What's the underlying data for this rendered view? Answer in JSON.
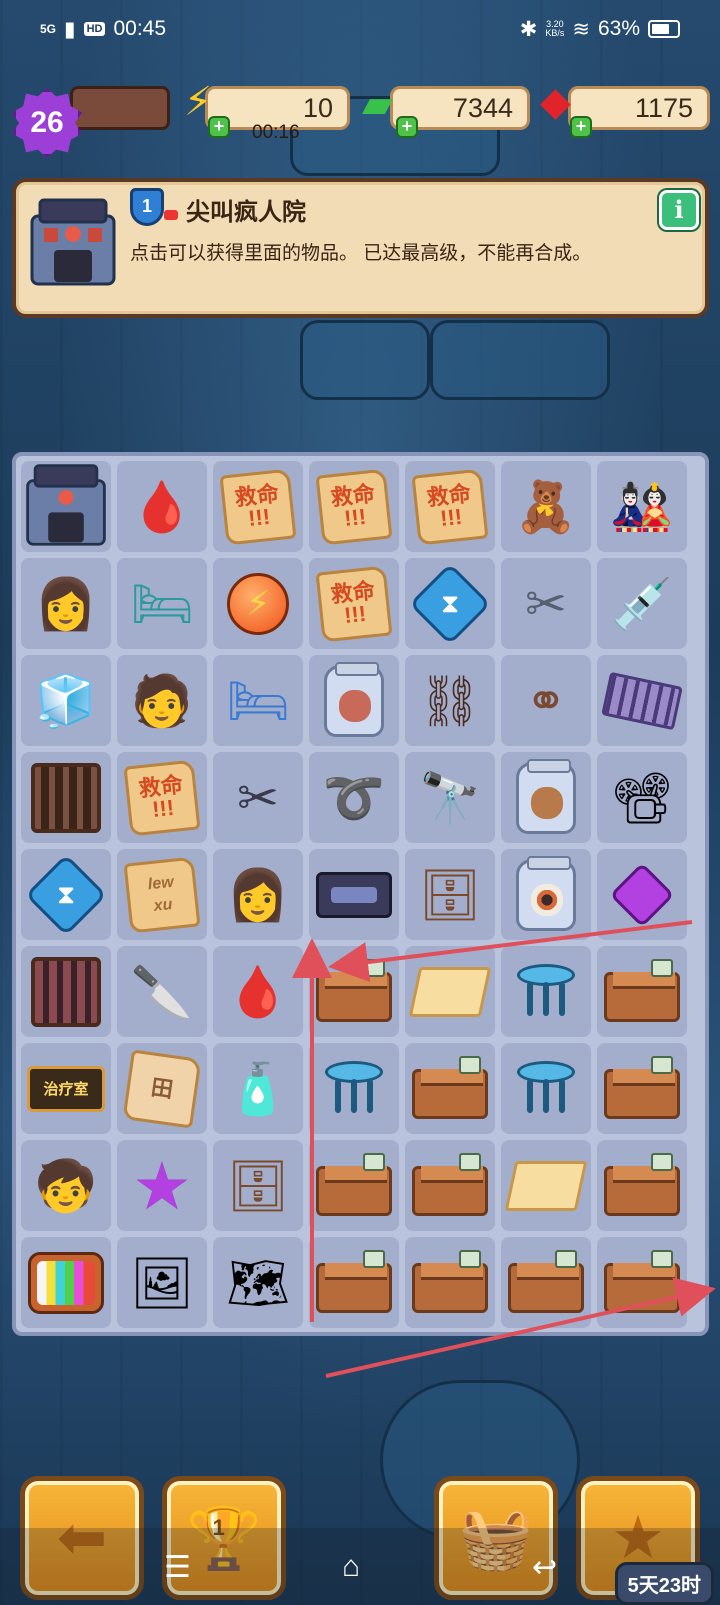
{
  "status_bar": {
    "network": "5G",
    "hd": "HD",
    "time": "00:45",
    "speed_value": "3.20",
    "speed_unit": "KB/s",
    "battery": "63%"
  },
  "resources": {
    "level": "26",
    "energy": "10",
    "energy_timer": "00:16",
    "cash": "7344",
    "gems": "1175"
  },
  "info_panel": {
    "tier": "1",
    "title": "尖叫疯人院",
    "description": "点击可以获得里面的物品。 已达最高级，不能再合成。",
    "info_button": "i"
  },
  "board": {
    "rows": [
      [
        "asylum-building",
        "iv-bag",
        "help-note",
        "help-note",
        "help-note",
        "toy-box",
        "nurse-doll"
      ],
      [
        "nurse-girl",
        "hospital-bed",
        "energy-orb",
        "help-note",
        "hourglass-gem",
        "tweezers",
        "syringe-set"
      ],
      [
        "color-cubes",
        "doctor-syringe",
        "hospital-bed-blue",
        "jar-lungs",
        "ball-chain",
        "handcuffs",
        "film-strip"
      ],
      [
        "cage",
        "help-note",
        "pliers",
        "whip",
        "binoculars",
        "jar-brain",
        "projector"
      ],
      [
        "hourglass-gem",
        "scribble-note",
        "nurse-girl",
        "cassette",
        "desk-items",
        "jar-eye",
        "purple-diamond"
      ],
      [
        "radiator",
        "scalpel",
        "iv-bag",
        "cardboard-box",
        "paper-sheet",
        "blue-stool",
        "cardboard-box"
      ],
      [
        "treatment-sign",
        "blueprint-paper",
        "medicine-bottle",
        "blue-stool",
        "cardboard-box",
        "blue-stool",
        "cardboard-box"
      ],
      [
        "kid-toys",
        "purple-star",
        "desk-items",
        "cardboard-box",
        "cardboard-box",
        "paper-sheet",
        "cardboard-box"
      ],
      [
        "retro-tv",
        "photos",
        "torn-photos",
        "cardboard-box",
        "cardboard-box",
        "cardboard-box",
        "cardboard-box"
      ]
    ],
    "help_note_text": "救命\n!!!",
    "scribble_text": "lew\nxu",
    "sign_text": "治疗室",
    "blueprint_text": "田"
  },
  "bottom_nav": {
    "back_icon": "back-arrow-icon",
    "trophy_rank": "1",
    "basket_icon": "basket-icon",
    "clipboard_icon": "clipboard-star-icon",
    "event_timer": "5天23时"
  },
  "colors": {
    "panel_bg": "#f1dcb6",
    "board_bg": "#b9c3dc",
    "cell_bg": "#a3aecd",
    "accent_orange": "#f7b63a",
    "arrow_red": "#e0505a"
  }
}
